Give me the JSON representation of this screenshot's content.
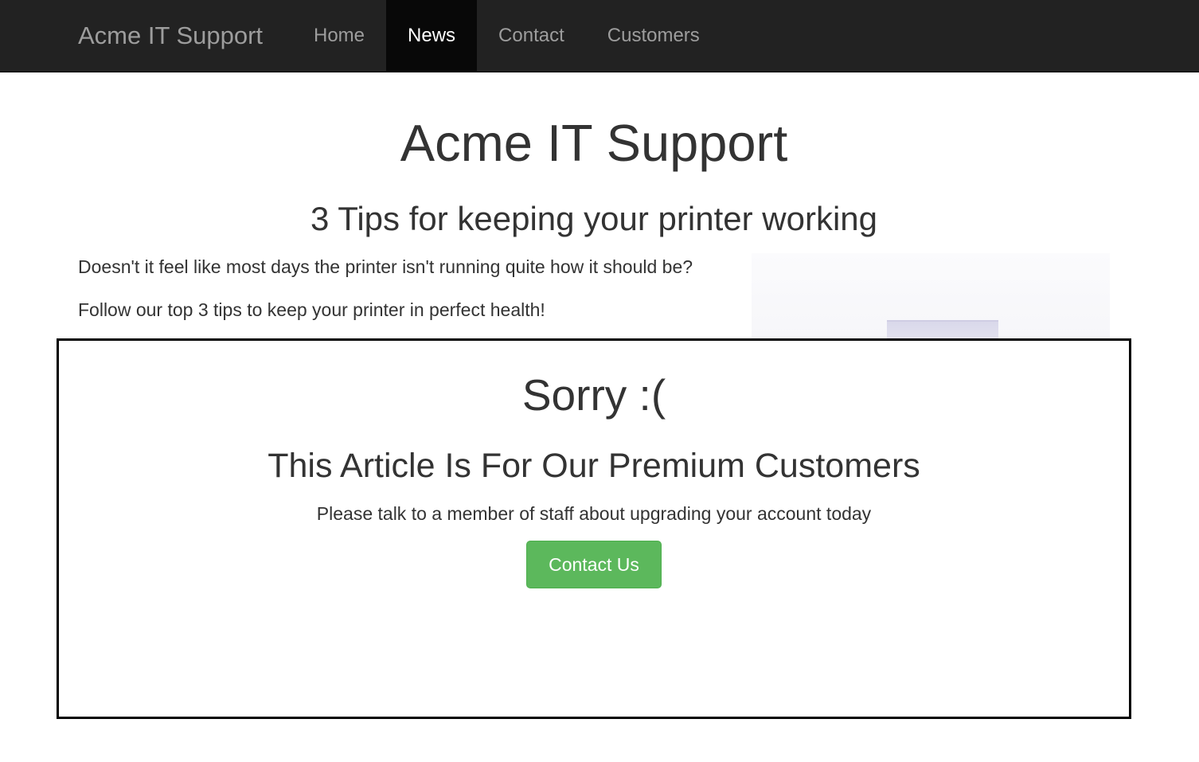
{
  "navbar": {
    "brand": "Acme IT Support",
    "items": [
      {
        "label": "Home",
        "active": false
      },
      {
        "label": "News",
        "active": true
      },
      {
        "label": "Contact",
        "active": false
      },
      {
        "label": "Customers",
        "active": false
      }
    ]
  },
  "main": {
    "site_title": "Acme IT Support",
    "article_title": "3 Tips for keeping your printer working",
    "paragraphs": [
      "Doesn't it feel like most days the printer isn't running quite how it should be?",
      "Follow our top 3 tips to keep your printer in perfect health!"
    ]
  },
  "paywall": {
    "sorry": "Sorry :(",
    "heading": "This Article Is For Our Premium Customers",
    "text": "Please talk to a member of staff about upgrading your account today",
    "button_label": "Contact Us"
  },
  "colors": {
    "navbar_bg": "#222222",
    "active_nav_bg": "#080808",
    "button_green": "#5cb85c"
  }
}
